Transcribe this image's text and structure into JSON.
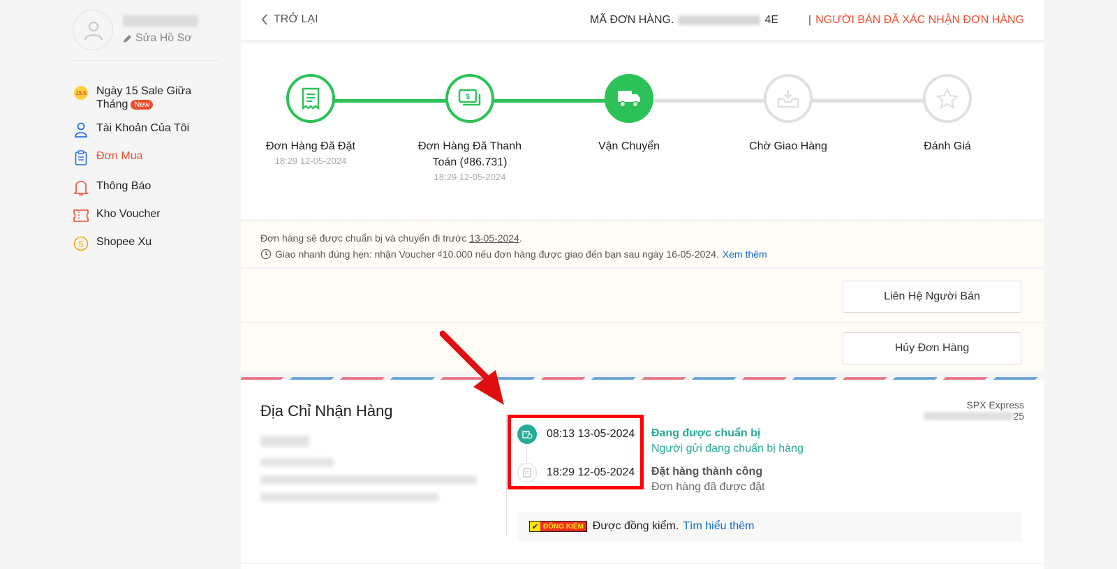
{
  "sidebar": {
    "edit_profile": "Sửa Hồ Sơ",
    "items": [
      {
        "label": "Ngày 15 Sale Giữa Tháng",
        "badge": "New",
        "icon": "sale-15-icon"
      },
      {
        "label": "Tài Khoản Của Tôi",
        "icon": "user-icon"
      },
      {
        "label": "Đơn Mua",
        "icon": "clipboard-icon",
        "active": true
      },
      {
        "label": "Thông Báo",
        "icon": "bell-icon"
      },
      {
        "label": "Kho Voucher",
        "icon": "voucher-icon"
      },
      {
        "label": "Shopee Xu",
        "icon": "coin-icon"
      }
    ]
  },
  "header": {
    "back_label": "TRỞ LẠI",
    "order_id_label": "MÃ ĐƠN HÀNG.",
    "order_id_suffix": "4E",
    "separator": "|",
    "status": "NGƯỜI BÁN ĐÃ XÁC NHẬN ĐƠN HÀNG"
  },
  "steps": [
    {
      "label": "Đơn Hàng Đã Đặt",
      "time": "18:29 12-05-2024",
      "state": "done"
    },
    {
      "label": "Đơn Hàng Đã Thanh Toán (₫86.731)",
      "time": "18:29 12-05-2024",
      "state": "done"
    },
    {
      "label": "Vận Chuyển",
      "time": "",
      "state": "current"
    },
    {
      "label": "Chờ Giao Hàng",
      "time": "",
      "state": "pending"
    },
    {
      "label": "Đánh Giá",
      "time": "",
      "state": "pending"
    }
  ],
  "notice": {
    "line1_prefix": "Đơn hàng sẽ được chuẩn bị và chuyển đi trước",
    "line1_date": "13-05-2024",
    "line1_suffix": ".",
    "line2": "Giao nhanh đúng hẹn: nhận Voucher ₫10.000 nếu đơn hàng được giao đến bạn sau ngày 16-05-2024.",
    "line2_link": "Xem thêm"
  },
  "actions": {
    "contact_seller": "Liên Hệ Người Bán",
    "cancel_order": "Hủy Đơn Hàng"
  },
  "address": {
    "title": "Địa Chỉ Nhận Hàng",
    "carrier": "SPX Express",
    "tracking_suffix": "25"
  },
  "timeline": [
    {
      "time": "08:13 13-05-2024",
      "title": "Đang được chuẩn bị",
      "desc": "Người gửi đang chuẩn bị hàng",
      "color": "#26aa99"
    },
    {
      "time": "18:29 12-05-2024",
      "title": "Đặt hàng thành công",
      "desc": "Đơn hàng đã được đặt",
      "color": "#555555"
    }
  ],
  "dongkiem": {
    "badge": "ĐỒNG KIỂM",
    "text": "Được đồng kiểm.",
    "link": "Tìm hiểu thêm"
  },
  "colors": {
    "brand": "#ee4d2d",
    "success": "#2dc258",
    "teal": "#26aa99",
    "link": "#0a68c2"
  }
}
